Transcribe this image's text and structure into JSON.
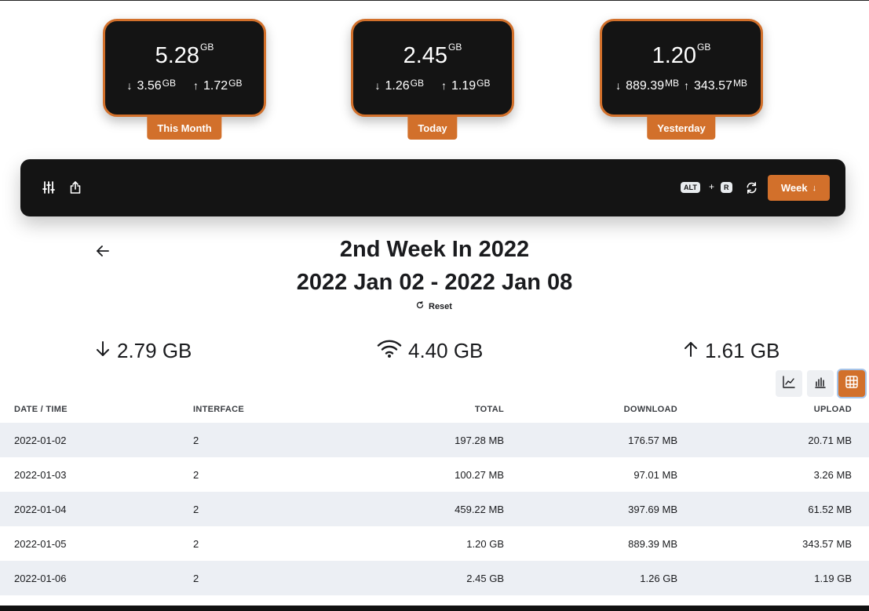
{
  "cards": [
    {
      "total": "5.28",
      "total_unit": "GB",
      "down": "3.56",
      "down_unit": "GB",
      "up": "1.72",
      "up_unit": "GB",
      "label": "This Month"
    },
    {
      "total": "2.45",
      "total_unit": "GB",
      "down": "1.26",
      "down_unit": "GB",
      "up": "1.19",
      "up_unit": "GB",
      "label": "Today"
    },
    {
      "total": "1.20",
      "total_unit": "GB",
      "down": "889.39",
      "down_unit": "MB",
      "up": "343.57",
      "up_unit": "MB",
      "label": "Yesterday"
    }
  ],
  "toolbar": {
    "shortcut_key1": "ALT",
    "shortcut_plus": "+",
    "shortcut_key2": "R",
    "period_label": "Week",
    "icons": [
      "sliders-icon",
      "share-icon",
      "refresh-icon",
      "arrow-down-icon"
    ]
  },
  "heading": {
    "title": "2nd Week In 2022",
    "range": "2022 Jan 02 - 2022 Jan 08",
    "reset_label": "Reset"
  },
  "summary": {
    "download": "2.79 GB",
    "total": "4.40 GB",
    "upload": "1.61 GB"
  },
  "view_modes": [
    "line-chart-icon",
    "bar-chart-icon",
    "table-icon"
  ],
  "active_view": "table",
  "table": {
    "columns": [
      "DATE / TIME",
      "INTERFACE",
      "TOTAL",
      "DOWNLOAD",
      "UPLOAD"
    ],
    "rows": [
      [
        "2022-01-02",
        "2",
        "197.28 MB",
        "176.57 MB",
        "20.71 MB"
      ],
      [
        "2022-01-03",
        "2",
        "100.27 MB",
        "97.01 MB",
        "3.26 MB"
      ],
      [
        "2022-01-04",
        "2",
        "459.22 MB",
        "397.69 MB",
        "61.52 MB"
      ],
      [
        "2022-01-05",
        "2",
        "1.20 GB",
        "889.39 MB",
        "343.57 MB"
      ],
      [
        "2022-01-06",
        "2",
        "2.45 GB",
        "1.26 GB",
        "1.19 GB"
      ]
    ]
  },
  "colors": {
    "accent": "#d2702b",
    "dark": "#141414",
    "row_alt": "#eceff4"
  }
}
